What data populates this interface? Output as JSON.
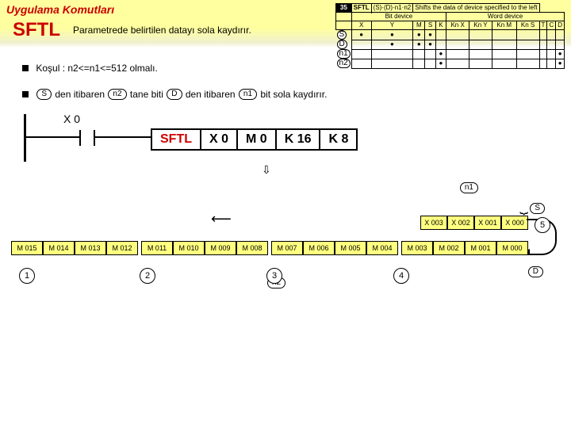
{
  "header": {
    "section": "Uygulama Komutları",
    "mnemonic": "SFTL",
    "description": "Parametrede belirtilen datayı sola kaydırır."
  },
  "opcode_table": {
    "mnemonic_cell": "SFTL",
    "note": "Shifts the data of device specified to the left",
    "ops": "(S)·(D)·n1·n2",
    "header_left": "Bit device",
    "header_right": "Word device",
    "cols_left": [
      "X",
      "Y",
      "M",
      "S",
      "K"
    ],
    "cols_right": [
      "Kn X",
      "Kn Y",
      "Kn M",
      "Kn S",
      "T",
      "C",
      "D"
    ]
  },
  "conditions": {
    "line1": "Koşul : n2<=n1<=512 olmalı.",
    "line2_parts": {
      "t1": "den itibaren",
      "t2": "tane biti",
      "t3": "den itibaren",
      "t4": "bit sola kaydırır."
    },
    "pills": {
      "s": "S",
      "n2": "n2",
      "d": "D",
      "n1": "n1"
    }
  },
  "ladder": {
    "contact": "X 0",
    "inst": [
      "SFTL",
      "X 0",
      "M 0",
      "K 16",
      "K 8"
    ]
  },
  "shift": {
    "brace_top": "n1",
    "s_side": "S",
    "brace_bot": "n2",
    "d_side": "D",
    "source": [
      "X 003",
      "X 002",
      "X 001",
      "X 000"
    ],
    "dest": [
      "M 015",
      "M 014",
      "M 013",
      "M 012",
      "M 011",
      "M 010",
      "M 009",
      "M 008",
      "M 007",
      "M 006",
      "M 005",
      "M 004",
      "M 003",
      "M 002",
      "M 001",
      "M 000"
    ],
    "circles": [
      "1",
      "2",
      "3",
      "4",
      "5"
    ]
  }
}
